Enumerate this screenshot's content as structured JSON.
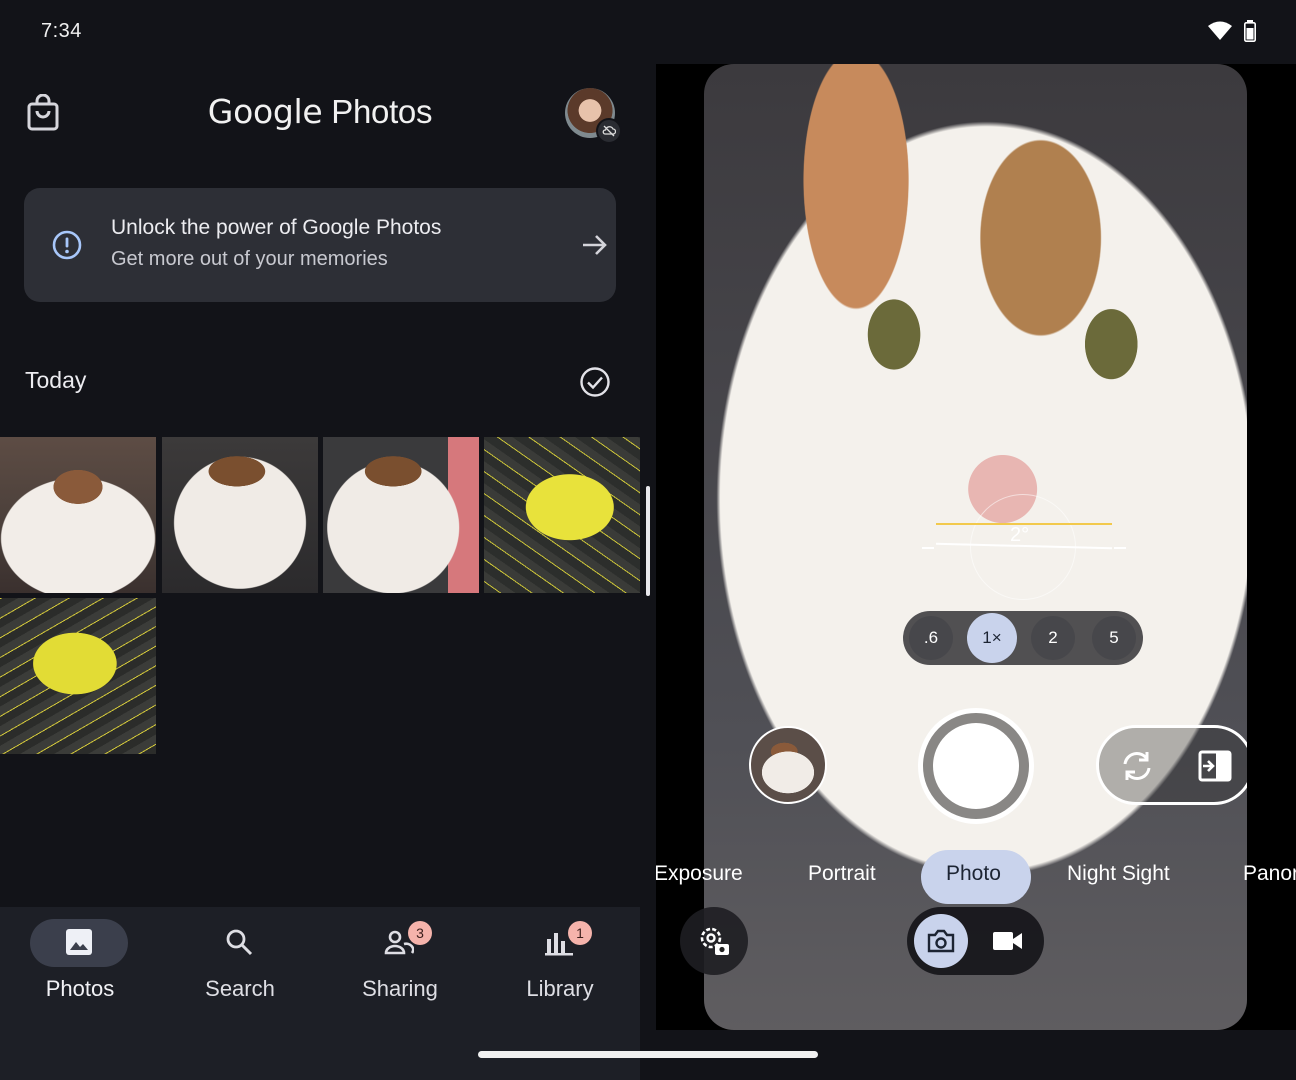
{
  "status_bar": {
    "time": "7:34",
    "icons": [
      "wifi-icon",
      "battery-icon"
    ]
  },
  "photos": {
    "header": {
      "title_google": "Google",
      "title_photos": "Photos",
      "left_icon": "shopping-bag-icon",
      "avatar_badge_icon": "cloud-off-icon"
    },
    "promo": {
      "title": "Unlock the power of Google Photos",
      "subtitle": "Get more out of your memories",
      "icon": "info-icon",
      "arrow_icon": "arrow-right-icon"
    },
    "section": {
      "title": "Today",
      "select_icon": "check-circle-icon"
    },
    "grid": [
      {
        "subject": "cat"
      },
      {
        "subject": "cat"
      },
      {
        "subject": "cat"
      },
      {
        "subject": "yellow mouse"
      },
      {
        "subject": "yellow mouse"
      }
    ],
    "nav": [
      {
        "label": "Photos",
        "icon": "photo-icon",
        "active": true
      },
      {
        "label": "Search",
        "icon": "search-icon"
      },
      {
        "label": "Sharing",
        "icon": "people-icon",
        "badge": "3"
      },
      {
        "label": "Library",
        "icon": "library-icon",
        "badge": "1"
      }
    ]
  },
  "camera": {
    "level_angle": "2°",
    "zoom": [
      {
        "label": ".6"
      },
      {
        "label": "1×",
        "active": true
      },
      {
        "label": "2"
      },
      {
        "label": "5"
      }
    ],
    "modes": [
      {
        "label": "Exposure"
      },
      {
        "label": "Portrait"
      },
      {
        "label": "Photo",
        "active": true
      },
      {
        "label": "Night Sight"
      },
      {
        "label": "Panor"
      }
    ],
    "icons": {
      "switch_camera": "camera-switch-icon",
      "dual_screen": "dual-screen-icon",
      "settings": "camera-settings-icon",
      "photo": "camera-icon",
      "video": "video-icon"
    },
    "colors": {
      "accent": "#c9d3ec"
    }
  }
}
